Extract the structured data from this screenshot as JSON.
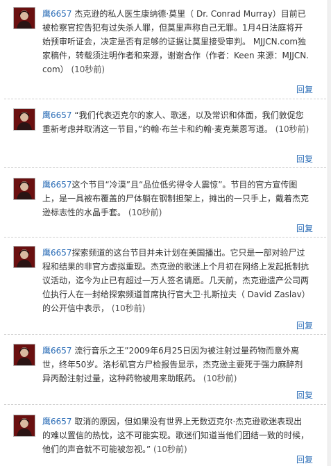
{
  "feed": {
    "posts": [
      {
        "author": "鹰6657",
        "content": " 杰克逊的私人医生康纳德·莫里（ Dr. Conrad Murray）目前已被检察官控告犯有过失杀人罪，但莫里声称自己无罪。1月4日法庭将开始预审听证会，决定是否有足够的证据让莫里接受审判。 MJJCN.com独家稿件，转载须注明作者和来源，谢谢合作（作者：Keen 来源：MJJCN.com）",
        "time": "(10秒前)",
        "reply": "回复"
      },
      {
        "author": "鹰6657",
        "content": " “我们代表迈克尔的家人、歌迷，以及常识和体面，我们敦促您重新考虑并取消这一节目，”约翰·布兰卡和约翰·麦克莱恩写道。",
        "time": "(10秒前)",
        "reply": "回复"
      },
      {
        "author": "鹰6657",
        "content": "这个节目“冷漠”且“品位低劣得令人震惊”。节目的官方宣传图上，是一具被布覆盖的尸体躺在钢制担架上，摊出的一只手上，戴着杰克逊标志性的水晶手套。",
        "time": "(10秒前)",
        "reply": "回复"
      },
      {
        "author": "鹰6657",
        "content": "探索频道的这台节目并未计划在美国播出。它只是一部对验尸过程和结果的非官方虚拟重现。杰克逊的歌迷上个月初在网络上发起抵制抗议活动，迄今为止已有超过一万人签名请愿。几天前，杰克逊遗产公司两位执行人在一封给探索频道首席执行官大卫·扎斯拉夫（ David Zaslav）的公开信中表示，",
        "time": "(10秒前)",
        "reply": "回复"
      },
      {
        "author": "鹰6657",
        "content": " 流行音乐之王”2009年6月25日因为被注射过量药物而意外离世，终年50岁。洛杉矶官方尸检报告显示，杰克逊主要死于强力麻醉剂异丙酚注射过量，这种药物被用来助眠药。",
        "time": "(10秒前)",
        "reply": "回复"
      },
      {
        "author": "鹰6657",
        "content": " 取消的原因，但如果没有世界上无数迈克尔·杰克逊歌迷表现出的难以置信的热忱，这不可能实现。歌迷们知道当他们团结一致的时候，他们的声音就不可能被忽视。”",
        "time": "(10秒前)",
        "reply": "回复"
      }
    ]
  }
}
